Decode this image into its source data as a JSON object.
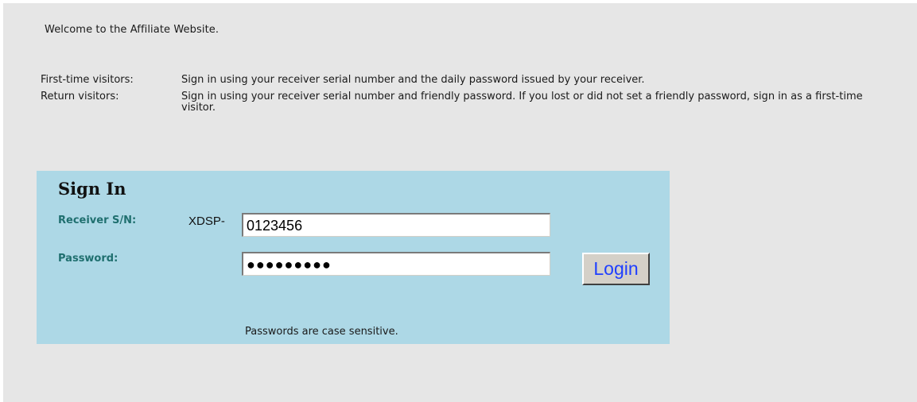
{
  "welcome": "Welcome to the Affiliate Website.",
  "info": {
    "first_time_label": "First-time visitors:",
    "first_time_text": "Sign in using your receiver serial number and the daily password issued by your receiver.",
    "return_label": "Return visitors:",
    "return_text": "Sign in using your receiver serial number and friendly password. If you lost or did not set a friendly password, sign in as a first-time visitor."
  },
  "signin": {
    "title": "Sign In",
    "serial_label": "Receiver S/N:",
    "serial_prefix": "XDSP-",
    "serial_value": "0123456",
    "password_label": "Password:",
    "password_value": "●●●●●●●●●",
    "login_label": "Login",
    "hint": "Passwords are case sensitive."
  },
  "colors": {
    "page_background": "#e6e6e6",
    "panel_background": "#add8e6",
    "label_color": "#1f6f6f",
    "button_text": "#1f3fff"
  }
}
